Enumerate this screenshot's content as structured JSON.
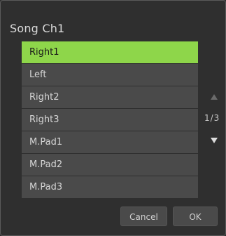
{
  "dialog": {
    "title": "Song Ch1"
  },
  "list": {
    "items": [
      {
        "label": "Right1",
        "selected": true
      },
      {
        "label": "Left",
        "selected": false
      },
      {
        "label": "Right2",
        "selected": false
      },
      {
        "label": "Right3",
        "selected": false
      },
      {
        "label": "M.Pad1",
        "selected": false
      },
      {
        "label": "M.Pad2",
        "selected": false
      },
      {
        "label": "M.Pad3",
        "selected": false
      }
    ]
  },
  "pager": {
    "indicator": "1/3",
    "up_enabled": false,
    "down_enabled": true
  },
  "buttons": {
    "cancel_label": "Cancel",
    "ok_label": "OK"
  },
  "colors": {
    "selected_item": "#8ed64a",
    "item_background": "#4a4a4a",
    "dialog_background": "#2f2f2f"
  }
}
